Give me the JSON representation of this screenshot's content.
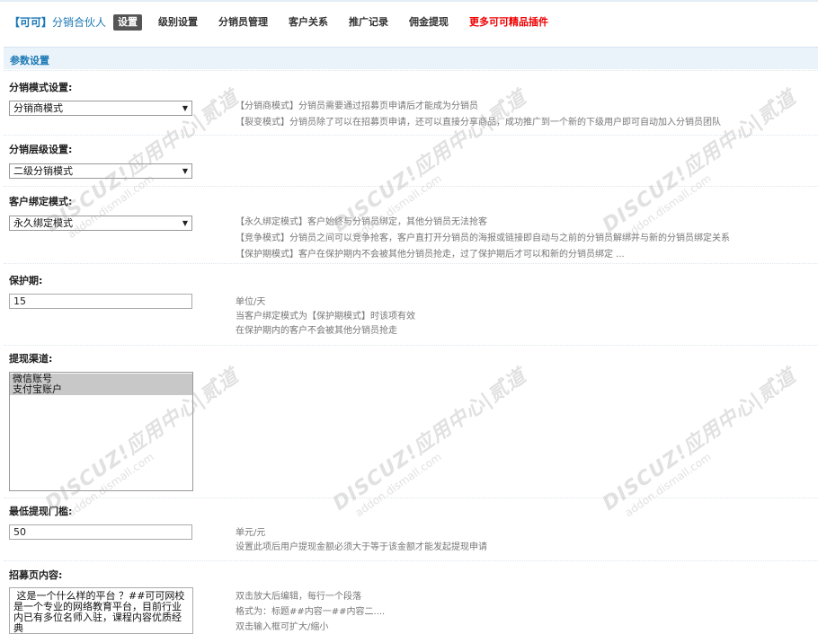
{
  "header": {
    "brand": "【可可】",
    "plugin_name": "分销合伙人",
    "nav": [
      {
        "label": "设置",
        "active": true
      },
      {
        "label": "级别设置"
      },
      {
        "label": "分销员管理"
      },
      {
        "label": "客户关系"
      },
      {
        "label": "推广记录"
      },
      {
        "label": "佣金提现"
      },
      {
        "label": "更多可可精品插件",
        "highlight": true
      }
    ]
  },
  "section_title": "参数设置",
  "fields": {
    "mode": {
      "label": "分销模式设置:",
      "value": "分销商模式",
      "tips": [
        "【分销商模式】分销员需要通过招募页申请后才能成为分销员",
        "【裂变模式】分销员除了可以在招募页申请，还可以直接分享商品，成功推广到一个新的下级用户即可自动加入分销员团队"
      ]
    },
    "level": {
      "label": "分销层级设置:",
      "value": "二级分销模式"
    },
    "binding": {
      "label": "客户绑定模式:",
      "value": "永久绑定模式",
      "tips": [
        "【永久绑定模式】客户始终与分销员绑定，其他分销员无法抢客",
        "【竞争模式】分销员之间可以竞争抢客，客户直打开分销员的海报或链接即自动与之前的分销员解绑并与新的分销员绑定关系",
        "【保护期模式】客户在保护期内不会被其他分销员抢走，过了保护期后才可以和新的分销员绑定 ..."
      ]
    },
    "protect": {
      "label": "保护期:",
      "value": "15",
      "tips": [
        "单位/天",
        "当客户绑定模式为【保护期模式】时该项有效",
        "在保护期内的客户不会被其他分销员抢走"
      ]
    },
    "withdraw": {
      "label": "提现渠道:",
      "options": [
        "微信账号",
        "支付宝账户"
      ]
    },
    "min_withdraw": {
      "label": "最低提现门槛:",
      "value": "50",
      "tips": [
        "单元/元",
        "设置此项后用户提现金额必须大于等于该金额才能发起提现申请"
      ]
    },
    "recruit": {
      "label": "招募页内容:",
      "value": " 这是一个什么样的平台 ？##可可网校是一个专业的网络教育平台，目前行业内已有多位名师入驻，课程内容优质经典\n 为什么要加入我们 ？##网校课程内容优质经",
      "tips": [
        "双击放大后编辑，每行一个段落",
        "格式为：标题##内容一##内容二....",
        "双击输入框可扩大/缩小"
      ]
    }
  },
  "watermark": {
    "main": "DISCUZ!应用中心|贰道",
    "sub": "addon.dismall.com"
  }
}
